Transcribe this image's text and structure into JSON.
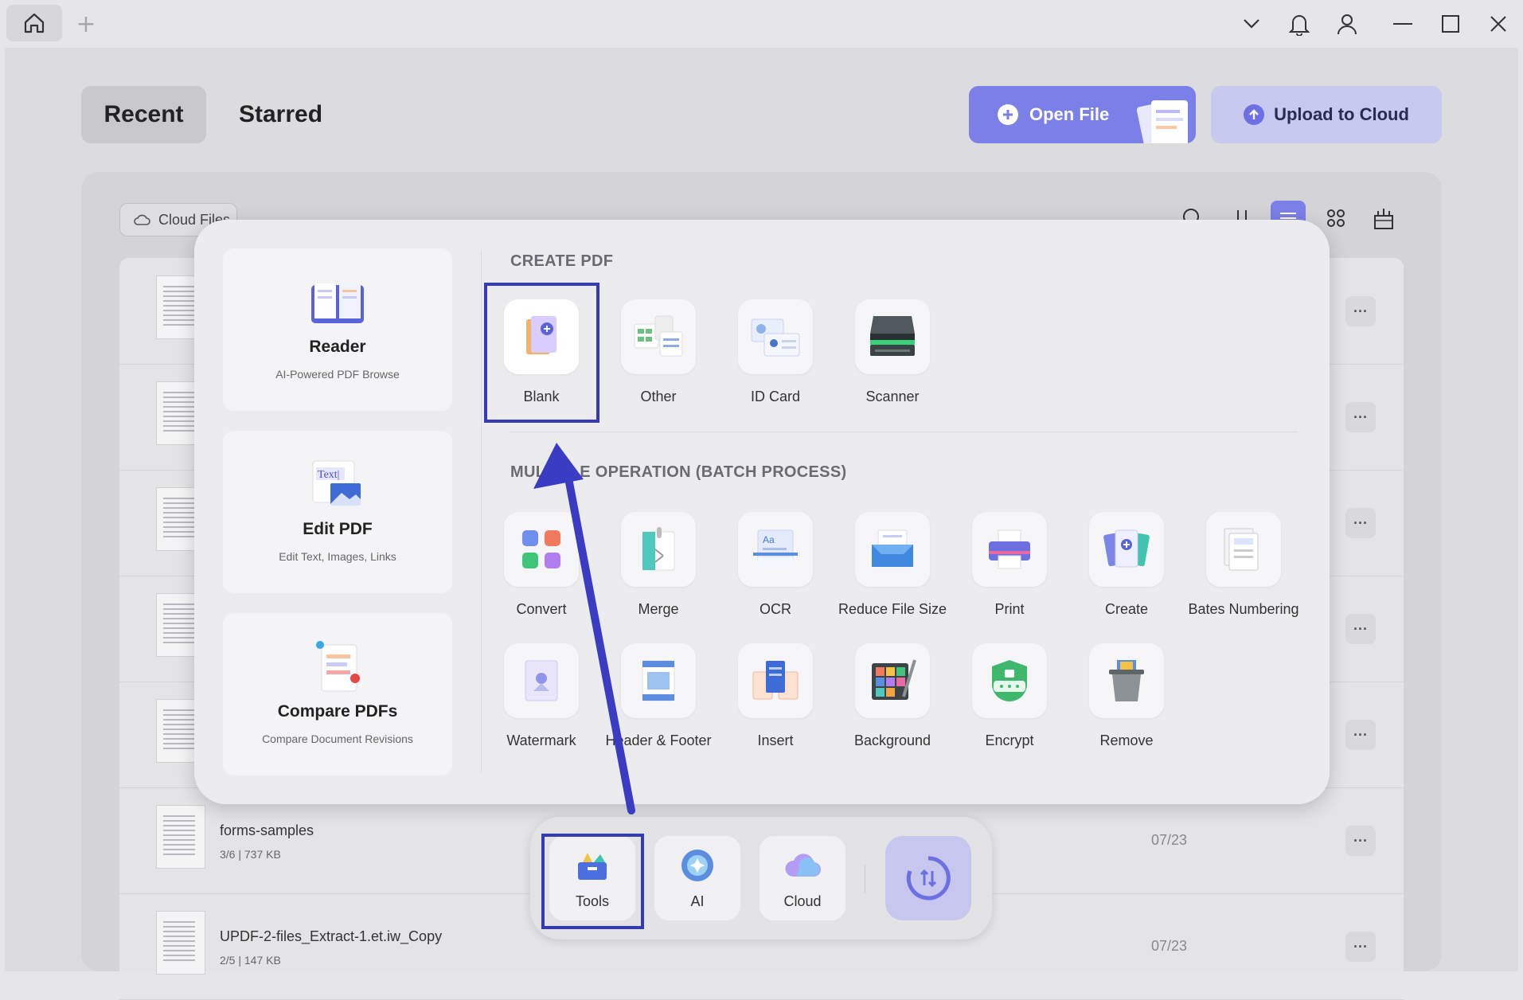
{
  "tabs": {
    "recent": "Recent",
    "starred": "Starred"
  },
  "actions": {
    "open_file": "Open File",
    "upload": "Upload to Cloud"
  },
  "cloud_filter": "Cloud Files",
  "files": [
    {
      "name": "forms-samples",
      "meta": "3/6 | 737 KB",
      "date": "07/23"
    },
    {
      "name": "UPDF-2-files_Extract-1.et.iw_Copy",
      "meta": "2/5 | 147 KB",
      "date": "07/23"
    }
  ],
  "popup": {
    "cards": [
      {
        "title": "Reader",
        "subtitle": "AI-Powered PDF Browse"
      },
      {
        "title": "Edit PDF",
        "subtitle": "Edit Text, Images, Links"
      },
      {
        "title": "Compare PDFs",
        "subtitle": "Compare Document Revisions"
      }
    ],
    "create_title": "CREATE PDF",
    "create_items": [
      "Blank",
      "Other",
      "ID Card",
      "Scanner"
    ],
    "batch_title": "MULTIPLE OPERATION (BATCH PROCESS)",
    "batch_row1": [
      "Convert",
      "Merge",
      "OCR",
      "Reduce File Size",
      "Print",
      "Create",
      "Bates Numbering"
    ],
    "batch_row2": [
      "Watermark",
      "Header & Footer",
      "Insert",
      "Background",
      "Encrypt",
      "Remove"
    ],
    "edit_icon_text": "Text|"
  },
  "dock": {
    "tools": "Tools",
    "ai": "AI",
    "cloud": "Cloud"
  },
  "colors": {
    "accent": "#7b7fe8",
    "highlight": "#3639b8"
  }
}
